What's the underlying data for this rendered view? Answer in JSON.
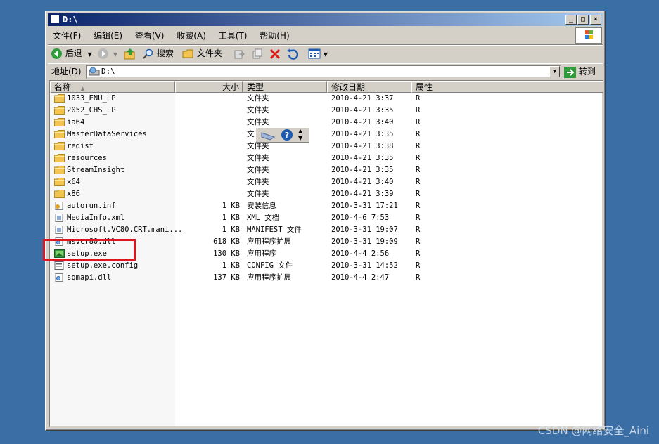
{
  "window": {
    "title": "D:\\"
  },
  "title_buttons": {
    "minimize": "_",
    "maximize": "□",
    "close": "×"
  },
  "menu": {
    "items": [
      {
        "label": "文件(F)"
      },
      {
        "label": "编辑(E)"
      },
      {
        "label": "查看(V)"
      },
      {
        "label": "收藏(A)"
      },
      {
        "label": "工具(T)"
      },
      {
        "label": "帮助(H)"
      }
    ]
  },
  "toolbar": {
    "back": "后退",
    "search": "搜索",
    "folders": "文件夹"
  },
  "address": {
    "label": "地址(D)",
    "value": "D:\\",
    "go": "转到"
  },
  "columns": {
    "name": "名称",
    "size": "大小",
    "type": "类型",
    "modified": "修改日期",
    "attributes": "属性"
  },
  "files": [
    {
      "name": "1033_ENU_LP",
      "size": "",
      "type": "文件夹",
      "modified": "2010-4-21 3:37",
      "attr": "R",
      "icon": "folder"
    },
    {
      "name": "2052_CHS_LP",
      "size": "",
      "type": "文件夹",
      "modified": "2010-4-21 3:35",
      "attr": "R",
      "icon": "folder"
    },
    {
      "name": "ia64",
      "size": "",
      "type": "文件夹",
      "modified": "2010-4-21 3:40",
      "attr": "R",
      "icon": "folder"
    },
    {
      "name": "MasterDataServices",
      "size": "",
      "type": "文",
      "modified": "2010-4-21 3:35",
      "attr": "R",
      "icon": "folder"
    },
    {
      "name": "redist",
      "size": "",
      "type": "文件夹",
      "modified": "2010-4-21 3:38",
      "attr": "R",
      "icon": "folder"
    },
    {
      "name": "resources",
      "size": "",
      "type": "文件夹",
      "modified": "2010-4-21 3:35",
      "attr": "R",
      "icon": "folder"
    },
    {
      "name": "StreamInsight",
      "size": "",
      "type": "文件夹",
      "modified": "2010-4-21 3:35",
      "attr": "R",
      "icon": "folder"
    },
    {
      "name": "x64",
      "size": "",
      "type": "文件夹",
      "modified": "2010-4-21 3:40",
      "attr": "R",
      "icon": "folder"
    },
    {
      "name": "x86",
      "size": "",
      "type": "文件夹",
      "modified": "2010-4-21 3:39",
      "attr": "R",
      "icon": "folder"
    },
    {
      "name": "autorun.inf",
      "size": "1 KB",
      "type": "安装信息",
      "modified": "2010-3-31 17:21",
      "attr": "R",
      "icon": "inf"
    },
    {
      "name": "MediaInfo.xml",
      "size": "1 KB",
      "type": "XML 文档",
      "modified": "2010-4-6 7:53",
      "attr": "R",
      "icon": "doc"
    },
    {
      "name": "Microsoft.VC80.CRT.mani...",
      "size": "1 KB",
      "type": "MANIFEST 文件",
      "modified": "2010-3-31 19:07",
      "attr": "R",
      "icon": "doc"
    },
    {
      "name": "msvcr80.dll",
      "size": "618 KB",
      "type": "应用程序扩展",
      "modified": "2010-3-31 19:09",
      "attr": "R",
      "icon": "dll"
    },
    {
      "name": "setup.exe",
      "size": "130 KB",
      "type": "应用程序",
      "modified": "2010-4-4 2:56",
      "attr": "R",
      "icon": "exe"
    },
    {
      "name": "setup.exe.config",
      "size": "1 KB",
      "type": "CONFIG 文件",
      "modified": "2010-3-31 14:52",
      "attr": "R",
      "icon": "config"
    },
    {
      "name": "sqmapi.dll",
      "size": "137 KB",
      "type": "应用程序扩展",
      "modified": "2010-4-4 2:47",
      "attr": "R",
      "icon": "dll"
    }
  ],
  "watermark": "CSDN @网络安全_Aini",
  "colors": {
    "desktop": "#3a6ea5",
    "titlebar_start": "#0a246a",
    "titlebar_end": "#a6caf0",
    "highlight_box": "#e0141e",
    "folder": "#f3c44f"
  }
}
